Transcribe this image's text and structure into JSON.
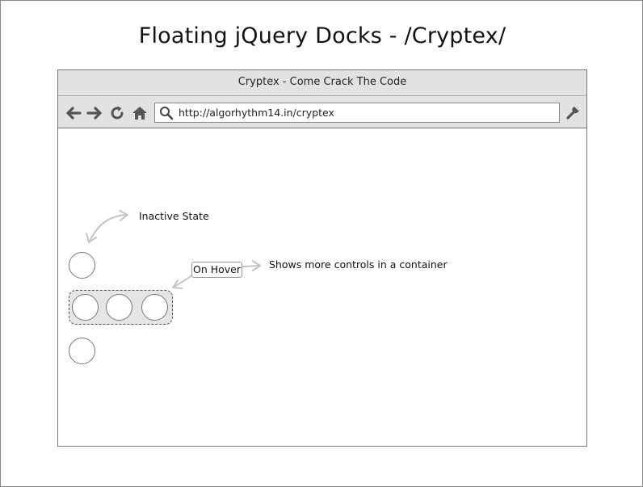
{
  "page": {
    "title": "Floating jQuery Docks - /Cryptex/"
  },
  "browser": {
    "window_title": "Cryptex - Come Crack The Code",
    "address_url": "http://algorhythm14.in/cryptex",
    "toolbar_icons": [
      "back-arrow-icon",
      "forward-arrow-icon",
      "reload-icon",
      "home-icon",
      "search-icon",
      "wrench-icon"
    ]
  },
  "annotations": {
    "inactive_state": "Inactive State",
    "on_hover": "On Hover",
    "shows_more": "Shows more controls in a container"
  },
  "dock": {
    "inactive_buttons": 2,
    "container_buttons": 3
  },
  "colors": {
    "chrome_bg": "#e2e2e2",
    "container_bg": "#e5e5e5",
    "arrow_stroke": "#c4c4c4"
  }
}
